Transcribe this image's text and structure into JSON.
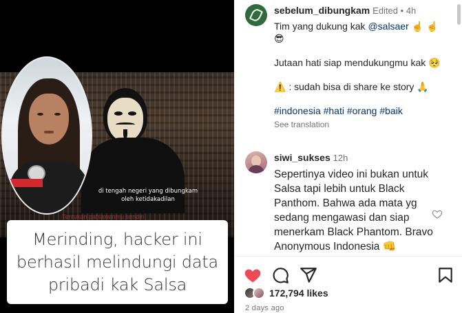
{
  "media": {
    "subtitle_white": "di tengah negeri yang dibungkam oleh ketidakadilan",
    "subtitle_red": "Tentukan pahlawanmu sendiri",
    "caption": "Merinding, hacker ini berhasil melindungi data pribadi kak Salsa"
  },
  "post_comment": {
    "username": "sebelum_dibungkam",
    "edited_label": "Edited",
    "time": "4h",
    "text_intro": "Tim yang dukung kak",
    "mention": "@salsaer",
    "emoji_hands": "☝️ ☝️",
    "emoji_sunglasses": "😎",
    "line2": "Jutaan hati siap mendukungmu kak 🥺",
    "line2_emoji": "🥺",
    "line3": "⚠️ : sudah bisa di share ke story 🙏",
    "hashtags": "#indonesia #hati #orang #baik",
    "see_translation": "See translation"
  },
  "reply_comment": {
    "username": "siwi_sukses",
    "time": "12h",
    "text": "Sepertinya video ini bukan untuk Salsa tapi lebih untuk Black Panthom. Bahwa ada mata yg sedang mengawasi dan siap menerkam Black Phantom. Bravo Anonymous Indonesia 👊"
  },
  "actions": {
    "likes": "172,794 likes",
    "posted": "2 days ago",
    "liked": true,
    "accent_like": "#ed4956"
  },
  "icons": [
    "heart-icon",
    "comment-icon",
    "share-icon",
    "bookmark-icon",
    "small-heart-icon"
  ]
}
